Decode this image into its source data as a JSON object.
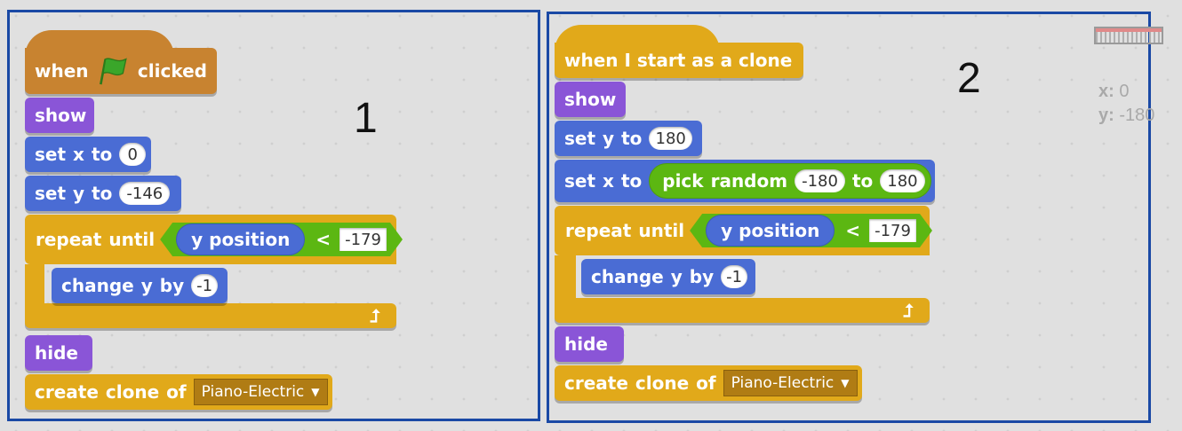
{
  "panels": [
    {
      "number": "1",
      "hat": {
        "when": "when",
        "clicked": "clicked",
        "icon": "green-flag-icon"
      },
      "show": "show",
      "set_x": {
        "label1": "set",
        "label2": "x",
        "label3": "to",
        "value": "0"
      },
      "set_y": {
        "label1": "set",
        "label2": "y",
        "label3": "to",
        "value": "-146"
      },
      "repeat": {
        "label1": "repeat",
        "label2": "until",
        "reporter": "y position",
        "op": "<",
        "value": "-179",
        "inner": {
          "label1": "change",
          "label2": "y",
          "label3": "by",
          "value": "-1"
        }
      },
      "hide": "hide",
      "create_clone": {
        "label1": "create",
        "label2": "clone",
        "label3": "of",
        "sprite": "Piano-Electric"
      }
    },
    {
      "number": "2",
      "hat": {
        "text": "when I start as a clone"
      },
      "show": "show",
      "set_y": {
        "label1": "set",
        "label2": "y",
        "label3": "to",
        "value": "180"
      },
      "set_x": {
        "label1": "set",
        "label2": "x",
        "label3": "to",
        "random": {
          "label1": "pick",
          "label2": "random",
          "from": "-180",
          "to_label": "to",
          "to": "180"
        }
      },
      "repeat": {
        "label1": "repeat",
        "label2": "until",
        "reporter": "y position",
        "op": "<",
        "value": "-179",
        "inner": {
          "label1": "change",
          "label2": "y",
          "label3": "by",
          "value": "-1"
        }
      },
      "hide": "hide",
      "create_clone": {
        "label1": "create",
        "label2": "clone",
        "label3": "of",
        "sprite": "Piano-Electric"
      }
    }
  ],
  "coords": {
    "x_label": "x:",
    "x_value": "0",
    "y_label": "y:",
    "y_value": "-180"
  },
  "colors": {
    "event": "#c88330",
    "control": "#e1a91a",
    "looks": "#8a55d7",
    "motion": "#4a6cd4",
    "operators": "#5cb712",
    "frame": "#1a49a5"
  }
}
